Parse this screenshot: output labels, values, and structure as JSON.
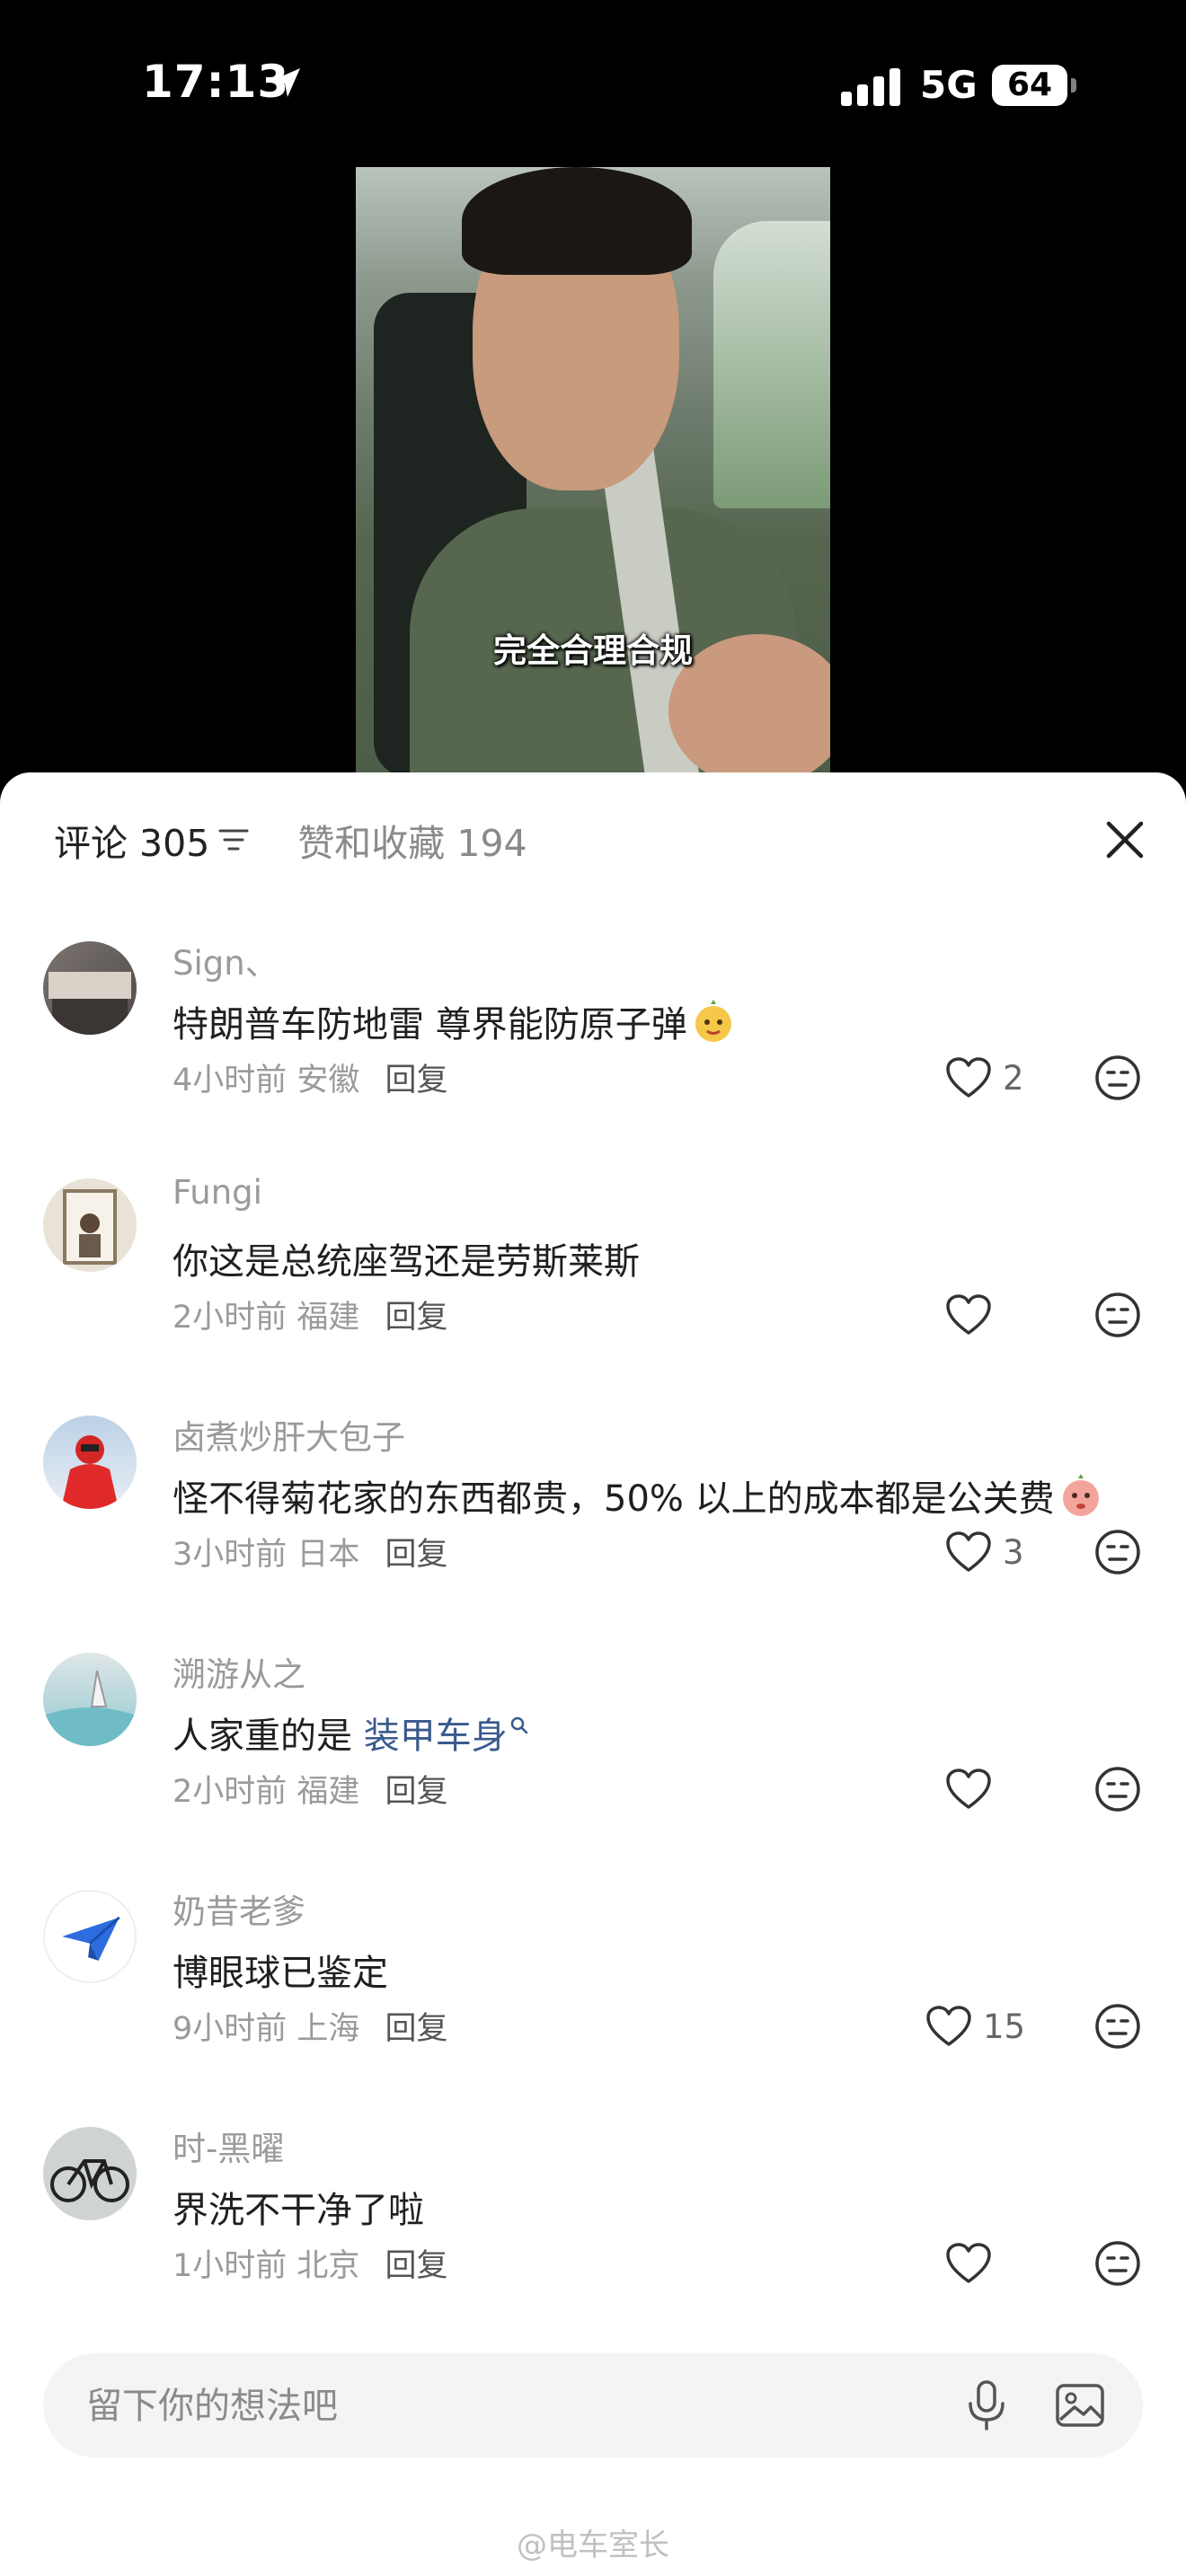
{
  "status_bar": {
    "time": "17:13",
    "network": "5G",
    "battery": "64"
  },
  "video": {
    "subtitle": "完全合理合规"
  },
  "header": {
    "comments_label": "评论",
    "comments_count": "305",
    "likes_label": "赞和收藏",
    "likes_count": "194"
  },
  "comments": [
    {
      "name": "Sign、",
      "text": "特朗普车防地雷 尊界能防原子弹",
      "emoji": "face-emoji",
      "time": "4小时前",
      "location": "安徽",
      "reply": "回复",
      "likes": "2"
    },
    {
      "name": "Fungi",
      "text": "你这是总统座驾还是劳斯莱斯",
      "time": "2小时前",
      "location": "福建",
      "reply": "回复",
      "likes": ""
    },
    {
      "name": "卤煮炒肝大包子",
      "text": "怪不得菊花家的东西都贵，50% 以上的成本都是公关费",
      "emoji": "face-emoji",
      "time": "3小时前",
      "location": "日本",
      "reply": "回复",
      "likes": "3"
    },
    {
      "name": "溯游从之",
      "text": "人家重的是 ",
      "link": "装甲车身",
      "time": "2小时前",
      "location": "福建",
      "reply": "回复",
      "likes": ""
    },
    {
      "name": "奶昔老爹",
      "text": "博眼球已鉴定",
      "time": "9小时前",
      "location": "上海",
      "reply": "回复",
      "likes": "15"
    },
    {
      "name": "时-黑曜",
      "text": "界洗不干净了啦",
      "time": "1小时前",
      "location": "北京",
      "reply": "回复",
      "likes": ""
    }
  ],
  "input": {
    "placeholder": "留下你的想法吧"
  },
  "watermark": "@电车室长",
  "colors": {
    "link": "#3a5a8c",
    "sheet_bg": "#ffffff",
    "muted": "#9a9a9a"
  }
}
